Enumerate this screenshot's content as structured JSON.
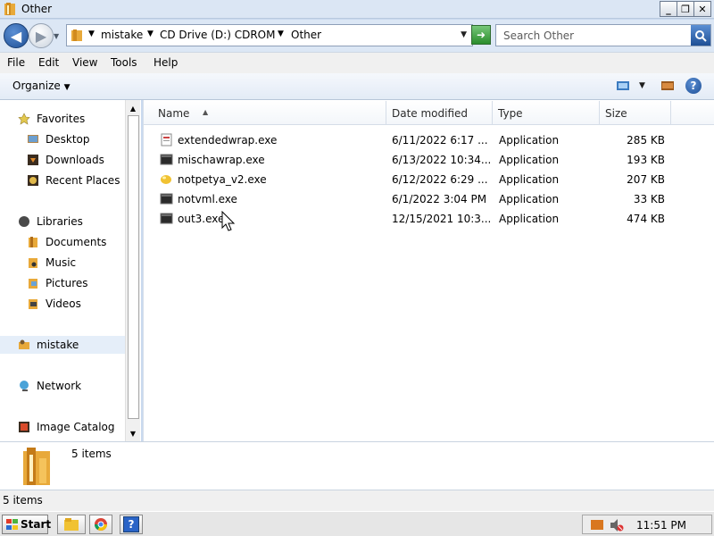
{
  "window": {
    "title": "Other",
    "minimize_label": "_",
    "maximize_label": "❐",
    "close_label": "✕"
  },
  "address": {
    "crumbs": [
      "mistake",
      "CD Drive (D:) CDROM",
      "Other"
    ],
    "back_glyph": "◀",
    "forward_glyph": "▶",
    "refresh_glyph": "➜",
    "search_placeholder": "Search Other"
  },
  "menu": {
    "items": [
      "File",
      "Edit",
      "View",
      "Tools",
      "Help"
    ]
  },
  "toolbar": {
    "organize_label": "Organize",
    "view_icon": "view-icon",
    "preview_icon": "preview-pane-icon",
    "help_icon": "help-icon",
    "help_glyph": "?"
  },
  "nav": {
    "favorites": {
      "label": "Favorites",
      "icon": "star-icon"
    },
    "favorites_items": [
      {
        "label": "Desktop",
        "icon": "desktop-icon"
      },
      {
        "label": "Downloads",
        "icon": "downloads-icon"
      },
      {
        "label": "Recent Places",
        "icon": "recent-places-icon"
      }
    ],
    "libraries": {
      "label": "Libraries",
      "icon": "libraries-icon"
    },
    "libraries_items": [
      {
        "label": "Documents",
        "icon": "documents-icon"
      },
      {
        "label": "Music",
        "icon": "music-icon"
      },
      {
        "label": "Pictures",
        "icon": "pictures-icon"
      },
      {
        "label": "Videos",
        "icon": "videos-icon"
      }
    ],
    "user": {
      "label": "mistake",
      "icon": "user-folder-icon"
    },
    "network": {
      "label": "Network",
      "icon": "network-icon"
    },
    "image_catalog": {
      "label": "Image Catalog",
      "icon": "image-catalog-icon"
    }
  },
  "columns": {
    "name": "Name",
    "date_modified": "Date modified",
    "type": "Type",
    "size": "Size"
  },
  "files": [
    {
      "name": "extendedwrap.exe",
      "date": "6/11/2022 6:17 ...",
      "type": "Application",
      "size": "285 KB",
      "icon": "doc-exe-icon"
    },
    {
      "name": "mischawrap.exe",
      "date": "6/13/2022 10:34...",
      "type": "Application",
      "size": "193 KB",
      "icon": "exe-icon"
    },
    {
      "name": "notpetya_v2.exe",
      "date": "6/12/2022 6:29 ...",
      "type": "Application",
      "size": "207 KB",
      "icon": "yellow-exe-icon"
    },
    {
      "name": "notvml.exe",
      "date": "6/1/2022 3:04 PM",
      "type": "Application",
      "size": "33 KB",
      "icon": "exe-icon"
    },
    {
      "name": "out3.exe",
      "date": "12/15/2021 10:3...",
      "type": "Application",
      "size": "474 KB",
      "icon": "exe-icon"
    }
  ],
  "details": {
    "count_text": "5 items",
    "icon": "folder-icon"
  },
  "status": {
    "text": "5 items"
  },
  "taskbar": {
    "start_label": "Start",
    "apps": [
      {
        "name": "explorer",
        "icon": "explorer-icon"
      },
      {
        "name": "chrome",
        "icon": "chrome-icon"
      },
      {
        "name": "help",
        "icon": "help-app-icon",
        "glyph": "?"
      }
    ],
    "clock": "11:51 PM"
  },
  "colors": {
    "accent_blue": "#1e4f95",
    "folder_yellow": "#e8a93a",
    "selection": "#e5eef9"
  }
}
